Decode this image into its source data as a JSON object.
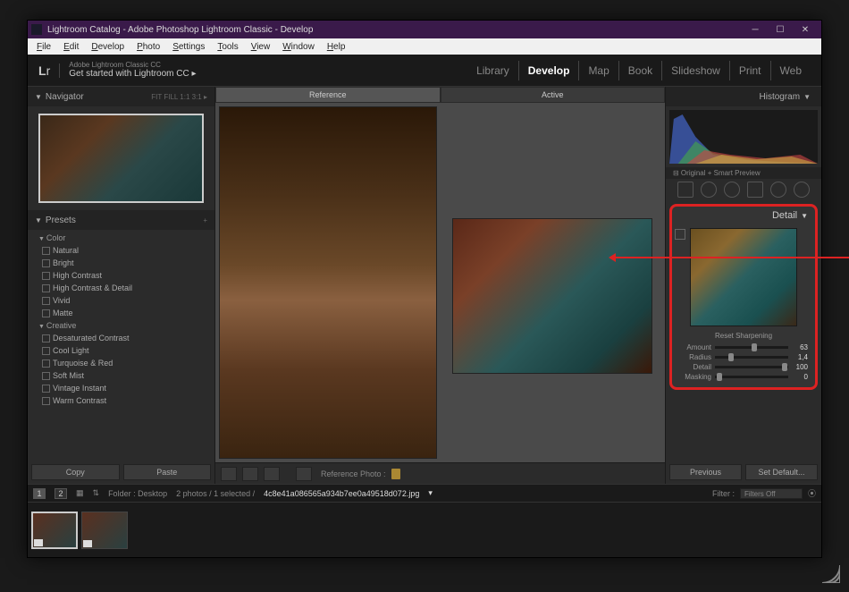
{
  "window": {
    "title": "Lightroom Catalog - Adobe Photoshop Lightroom Classic - Develop"
  },
  "menubar": [
    "File",
    "Edit",
    "Develop",
    "Photo",
    "Settings",
    "Tools",
    "View",
    "Window",
    "Help"
  ],
  "header": {
    "logo_pre": "L",
    "logo_post": "r",
    "id_small": "Adobe Lightroom Classic CC",
    "id_main": "Get started with Lightroom CC  ▸",
    "modules": [
      "Library",
      "Develop",
      "Map",
      "Book",
      "Slideshow",
      "Print",
      "Web"
    ],
    "active_module": "Develop"
  },
  "navigator": {
    "title": "Navigator",
    "options": "FIT   FILL   1:1   3:1  ▸"
  },
  "presets": {
    "title": "Presets",
    "groups": [
      {
        "name": "Color",
        "items": [
          "Natural",
          "Bright",
          "High Contrast",
          "High Contrast & Detail",
          "Vivid",
          "Matte"
        ]
      },
      {
        "name": "Creative",
        "items": [
          "Desaturated Contrast",
          "Cool Light",
          "Turquoise & Red",
          "Soft Mist",
          "Vintage Instant",
          "Warm Contrast"
        ]
      }
    ]
  },
  "buttons": {
    "copy": "Copy",
    "paste": "Paste",
    "previous": "Previous",
    "setdefault": "Set Default..."
  },
  "viewtabs": {
    "reference": "Reference",
    "active": "Active"
  },
  "toolbar": {
    "refphoto": "Reference Photo :"
  },
  "right": {
    "histogram": "Histogram",
    "preview_note": "⊟ Original + Smart Preview",
    "detail": {
      "title": "Detail",
      "reset": "Reset Sharpening",
      "rows": [
        {
          "name": "Amount",
          "value": "63",
          "pos": 50
        },
        {
          "name": "Radius",
          "value": "1,4",
          "pos": 18
        },
        {
          "name": "Detail",
          "value": "100",
          "pos": 92
        },
        {
          "name": "Masking",
          "value": "0",
          "pos": 2
        }
      ]
    }
  },
  "footer": {
    "pages": [
      "1",
      "2"
    ],
    "folder": "Folder : Desktop",
    "count": "2 photos / 1 selected /",
    "filename": "4c8e41a086565a934b7ee0a49518d072.jpg",
    "filter": "Filter :",
    "filters_off": "Filters Off"
  }
}
